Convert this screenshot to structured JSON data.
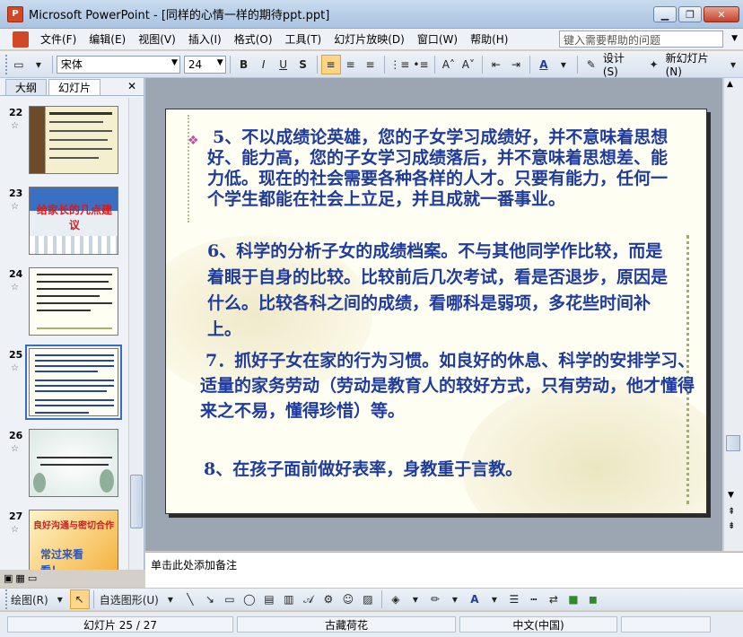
{
  "window": {
    "title": "Microsoft PowerPoint - [同样的心情一样的期待ppt.ppt]"
  },
  "menu": {
    "items": [
      "文件(F)",
      "编辑(E)",
      "视图(V)",
      "插入(I)",
      "格式(O)",
      "工具(T)",
      "幻灯片放映(D)",
      "窗口(W)",
      "帮助(H)"
    ],
    "help_placeholder": "键入需要帮助的问题"
  },
  "format_toolbar": {
    "font": "宋体",
    "size": "24",
    "design_label": "设计(S)",
    "new_slide_label": "新幻灯片(N)"
  },
  "left_panel": {
    "tabs": [
      "大纲",
      "幻灯片"
    ],
    "slides": [
      {
        "num": "22"
      },
      {
        "num": "23",
        "title": "给家长的几点建议"
      },
      {
        "num": "24"
      },
      {
        "num": "25"
      },
      {
        "num": "26"
      },
      {
        "num": "27",
        "title": "良好沟通与密切合作",
        "line2": "常过来看",
        "line3": "看！"
      }
    ]
  },
  "slide": {
    "p5": "5、不以成绩论英雄，您的子女学习成绩好，并不意味着思想好、能力高，您的子女学习成绩落后，并不意味着思想差、能力低。现在的社会需要各种各样的人才。只要有能力，任何一个学生都能在社会上立足，并且成就一番事业。",
    "p6": "6、科学的分析子女的成绩档案。不与其他同学作比较，而是着眼于自身的比较。比较前后几次考试，看是否退步，原因是什么。比较各科之间的成绩，看哪科是弱项，多花些时间补上。",
    "p7": "7．抓好子女在家的行为习惯。如良好的休息、科学的安排学习、适量的家务劳动（劳动是教育人的较好方式，只有劳动，他才懂得来之不易，懂得珍惜）等。",
    "p8": "8、在孩子面前做好表率，身教重于言教。"
  },
  "notes": {
    "placeholder": "单击此处添加备注"
  },
  "draw_toolbar": {
    "draw_label": "绘图(R)",
    "autoshape_label": "自选图形(U)"
  },
  "status": {
    "slide": "幻灯片 25 / 27",
    "design": "古藏荷花",
    "language": "中文(中国)"
  },
  "colors": {
    "slide_text": "#1f3c9c",
    "title_bar": "#a9c3e1"
  }
}
